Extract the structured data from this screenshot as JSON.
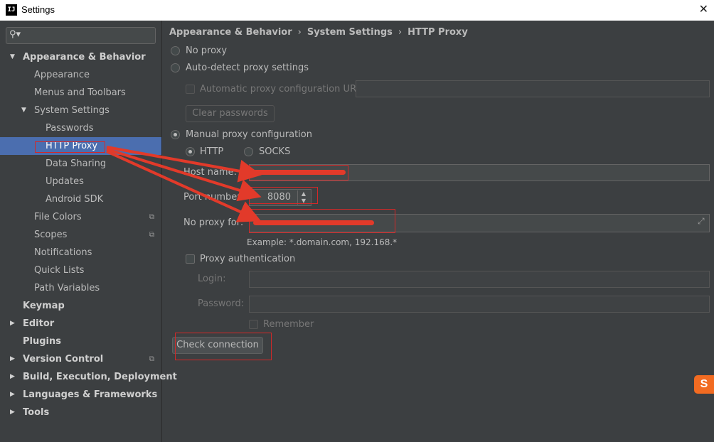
{
  "window": {
    "title": "Settings",
    "app_icon": "IJ"
  },
  "search": {
    "placeholder": ""
  },
  "sidebar": {
    "items": [
      {
        "label": "Appearance & Behavior"
      },
      {
        "label": "Appearance"
      },
      {
        "label": "Menus and Toolbars"
      },
      {
        "label": "System Settings"
      },
      {
        "label": "Passwords"
      },
      {
        "label": "HTTP Proxy"
      },
      {
        "label": "Data Sharing"
      },
      {
        "label": "Updates"
      },
      {
        "label": "Android SDK"
      },
      {
        "label": "File Colors"
      },
      {
        "label": "Scopes"
      },
      {
        "label": "Notifications"
      },
      {
        "label": "Quick Lists"
      },
      {
        "label": "Path Variables"
      },
      {
        "label": "Keymap"
      },
      {
        "label": "Editor"
      },
      {
        "label": "Plugins"
      },
      {
        "label": "Version Control"
      },
      {
        "label": "Build, Execution, Deployment"
      },
      {
        "label": "Languages & Frameworks"
      },
      {
        "label": "Tools"
      }
    ]
  },
  "breadcrumb": [
    "Appearance & Behavior",
    "System Settings",
    "HTTP Proxy"
  ],
  "breadcrumb_sep": "›",
  "proxy": {
    "no_proxy": "No proxy",
    "auto_detect": "Auto-detect proxy settings",
    "auto_config_url": "Automatic proxy configuration URL:",
    "clear_passwords": "Clear passwords",
    "manual": "Manual proxy configuration",
    "http": "HTTP",
    "socks": "SOCKS",
    "host_label": "Host name:",
    "port_label": "Port number:",
    "port_value": "8080",
    "no_proxy_for_label": "No proxy for:",
    "example": "Example: *.domain.com, 192.168.*",
    "proxy_auth": "Proxy authentication",
    "login_label": "Login:",
    "password_label": "Password:",
    "remember": "Remember",
    "check_connection": "Check connection",
    "selected_mode": "manual",
    "selected_protocol": "HTTP"
  },
  "colors": {
    "selection": "#4b6eaf",
    "annotation": "#e23a2a",
    "background": "#3c3f41"
  }
}
